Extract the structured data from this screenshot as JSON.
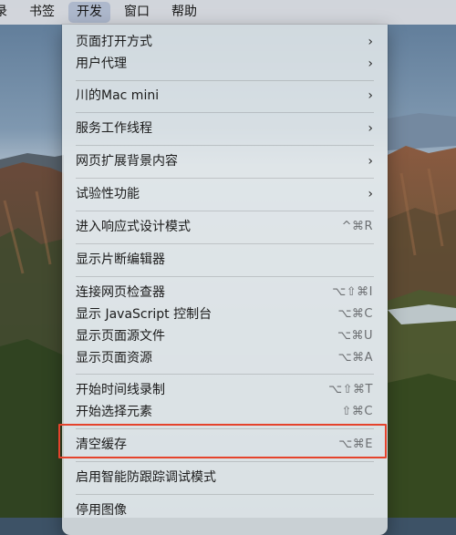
{
  "menubar": {
    "items": [
      "录",
      "书签",
      "开发",
      "窗口",
      "帮助"
    ],
    "active_index": 2
  },
  "menu": {
    "items": [
      {
        "label": "页面打开方式",
        "submenu": true
      },
      {
        "label": "用户代理",
        "submenu": true
      },
      {
        "label": "川的Mac mini",
        "submenu": true
      },
      {
        "label": "服务工作线程",
        "submenu": true
      },
      {
        "label": "网页扩展背景内容",
        "submenu": true
      },
      {
        "label": "试验性功能",
        "submenu": true
      },
      {
        "label": "进入响应式设计模式",
        "shortcut": "^⌘R"
      },
      {
        "label": "显示片断编辑器"
      },
      {
        "label": "连接网页检查器",
        "shortcut": "⌥⇧⌘I"
      },
      {
        "label": "显示 JavaScript 控制台",
        "shortcut": "⌥⌘C"
      },
      {
        "label": "显示页面源文件",
        "shortcut": "⌥⌘U"
      },
      {
        "label": "显示页面资源",
        "shortcut": "⌥⌘A"
      },
      {
        "label": "开始时间线录制",
        "shortcut": "⌥⇧⌘T"
      },
      {
        "label": "开始选择元素",
        "shortcut": "⇧⌘C"
      },
      {
        "label": "清空缓存",
        "shortcut": "⌥⌘E",
        "highlighted": true
      },
      {
        "label": "启用智能防跟踪调试模式"
      },
      {
        "label": "停用图像"
      }
    ],
    "chevron_glyph": "›"
  },
  "colors": {
    "highlight_border": "#e5432c",
    "menubar_active": "#adb8cc"
  }
}
